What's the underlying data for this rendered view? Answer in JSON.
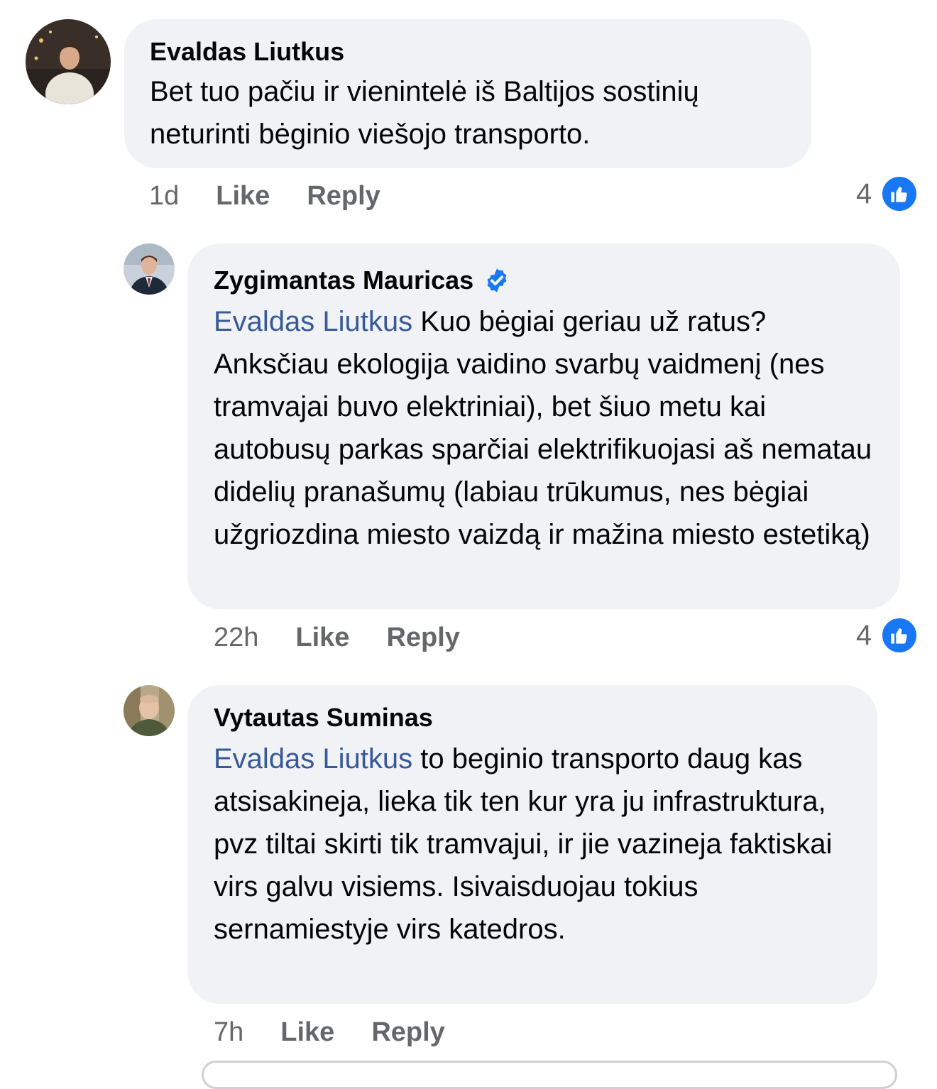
{
  "comments": [
    {
      "author": "Evaldas Liutkus",
      "text": "Bet tuo pačiu ir vienintelė iš Baltijos sostinių neturinti bėginio viešojo transporto.",
      "time": "1d",
      "like_label": "Like",
      "reply_label": "Reply",
      "reaction_count": "4",
      "reaction_icon": "like-icon",
      "verified": false
    },
    {
      "author": "Zygimantas Mauricas",
      "mention": "Evaldas Liutkus",
      "text": "Kuo bėgiai geriau už ratus? Anksčiau ekologija vaidino svarbų vaidmenį (nes tramvajai buvo elektriniai), bet šiuo metu kai autobusų parkas sparčiai elektrifikuojasi aš nematau didelių pranašumų (labiau trūkumus, nes bėgiai užgriozdina miesto vaizdą ir mažina miesto estetiką)",
      "time": "22h",
      "like_label": "Like",
      "reply_label": "Reply",
      "reaction_count": "4",
      "reaction_icon": "like-icon",
      "verified": true
    },
    {
      "author": "Vytautas Suminas",
      "mention": "Evaldas Liutkus",
      "text": "to beginio transporto daug kas atsisakineja, lieka tik ten kur yra ju infrastruktura, pvz tiltai skirti tik tramvajui, ir jie vazineja faktiskai virs galvu visiems. Isivaisduojau tokius sernamiestyje virs katedros.",
      "time": "7h",
      "like_label": "Like",
      "reply_label": "Reply",
      "verified": false
    }
  ],
  "colors": {
    "bubble": "#f0f2f5",
    "mention": "#385898",
    "meta": "#65676b",
    "like_blue": "#1877f2",
    "verified_blue": "#1877f2"
  }
}
